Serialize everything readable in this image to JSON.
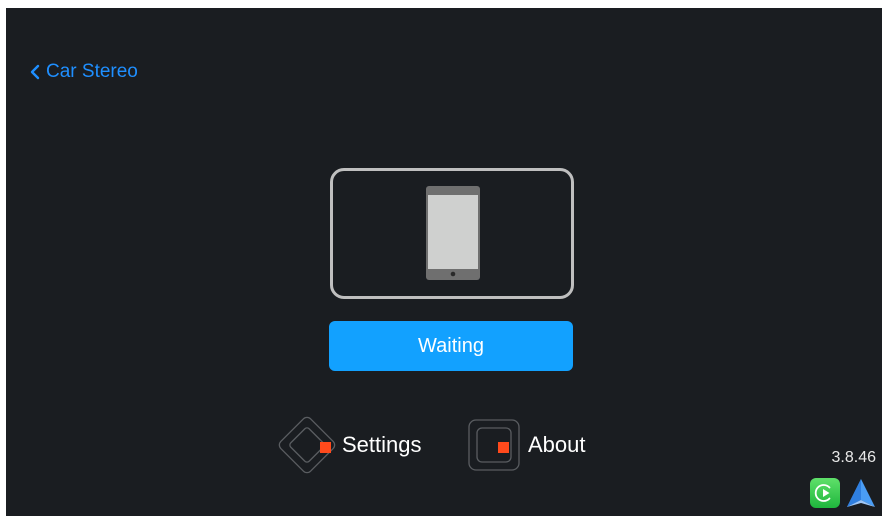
{
  "header": {
    "back_label": "Car Stereo",
    "back_icon": "chevron-left-icon"
  },
  "main": {
    "phone_icon": "smartphone-icon",
    "status_button_label": "Waiting"
  },
  "menu": {
    "items": [
      {
        "label": "Settings",
        "icon": "settings-icon"
      },
      {
        "label": "About",
        "icon": "about-icon"
      }
    ]
  },
  "footer": {
    "version": "3.8.46",
    "icons": [
      "carplay-icon",
      "android-auto-icon"
    ]
  },
  "colors": {
    "background": "#1a1d21",
    "accent": "#1f8fff",
    "button": "#12a1ff",
    "menu_marker": "#ff4a1c",
    "carplay_green": "#34c759",
    "android_auto_blue": "#4a9df5"
  }
}
